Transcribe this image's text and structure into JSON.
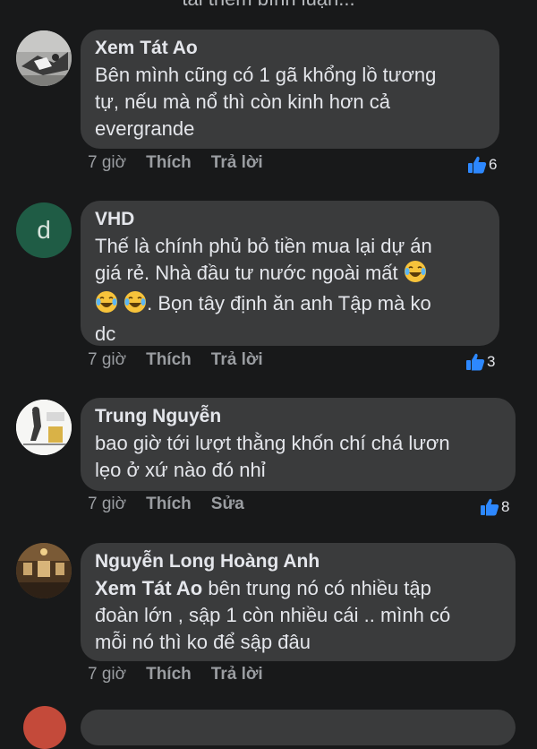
{
  "top_text": "tải thêm bình luận...",
  "comments": [
    {
      "name": "Xem Tát Ao",
      "lines": [
        "Bên mình cũng có 1 gã khổng lồ tương",
        "tự, nếu mà nổ thì còn kinh hơn cả",
        "evergrande"
      ],
      "time": "7 giờ",
      "like_label": "Thích",
      "reply_label": "Trả lời",
      "reaction_count": "6"
    },
    {
      "name": "VHD",
      "avatar_letter": "d",
      "avatar_color": "#1f5c45",
      "lines": [
        "Thế là chính phủ bỏ tiền mua lại dự án",
        "giá rẻ. Nhà đầu tư nước ngoài mất",
        ". Bọn tây định ăn anh Tập mà ko",
        "dc"
      ],
      "time": "7 giờ",
      "like_label": "Thích",
      "reply_label": "Trả lời",
      "reaction_count": "3"
    },
    {
      "name": "Trung Nguyễn",
      "lines": [
        "bao giờ tới lượt thằng khốn chí chá lươn",
        "lẹo ở xứ nào đó nhỉ"
      ],
      "time": "7 giờ",
      "like_label": "Thích",
      "edit_label": "Sửa",
      "reaction_count": "8"
    },
    {
      "name": "Nguyễn Long Hoàng Anh",
      "mention": "Xem Tát Ao",
      "lines": [
        " bên trung nó có nhiều tập",
        "đoàn lớn , sập 1 còn nhiều cái .. mình có",
        "mỗi nó thì ko để sập đâu"
      ],
      "time": "7 giờ",
      "like_label": "Thích",
      "reply_label": "Trả lời"
    }
  ],
  "colors": {
    "background": "#18191a",
    "bubble": "#3a3b3c",
    "text": "#e4e6eb",
    "meta": "#9a9da1",
    "like_blue": "#2d88ff"
  },
  "icons": {
    "reaction": "thumbs-up-icon",
    "emoji": "laughing-tears-emoji-icon"
  }
}
